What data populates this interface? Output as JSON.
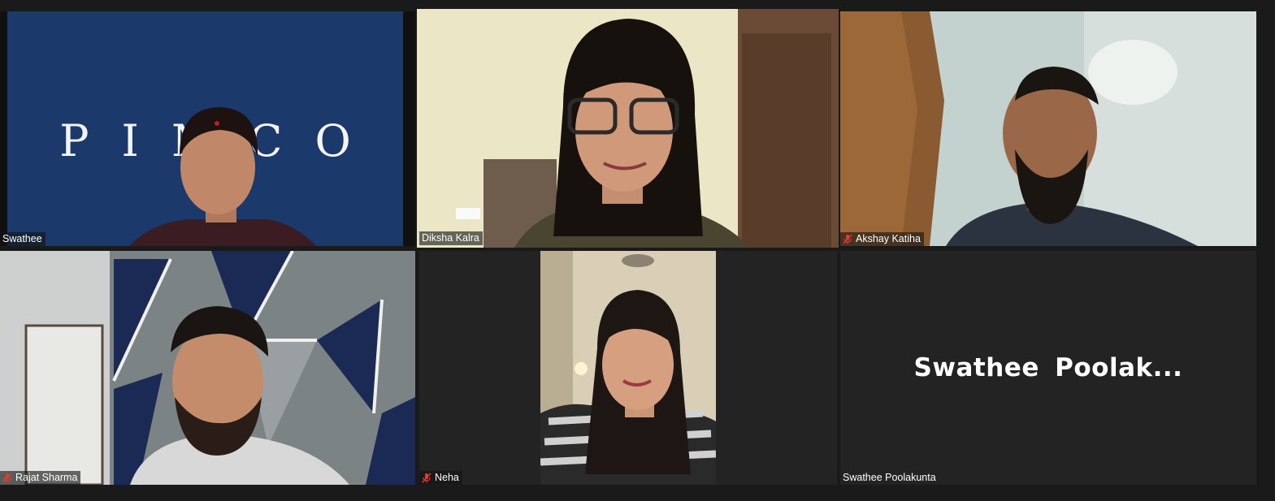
{
  "participants": [
    {
      "name": "Swathee",
      "muted": false,
      "background_logo": "PIMCO"
    },
    {
      "name": "Diksha Kalra",
      "muted": false,
      "active_speaker": true
    },
    {
      "name": "Akshay Katiha",
      "muted": true
    },
    {
      "name": "Rajat Sharma",
      "muted": true
    },
    {
      "name": "Neha",
      "muted": true
    },
    {
      "name": "Swathee Poolakunta",
      "muted": false,
      "video_off": true,
      "display_name_truncated": "Swathee Poolak..."
    }
  ],
  "colors": {
    "active_speaker_border": "#c8ec3a",
    "muted_icon": "#e53935",
    "pimco_background": "#1b3a6b"
  }
}
